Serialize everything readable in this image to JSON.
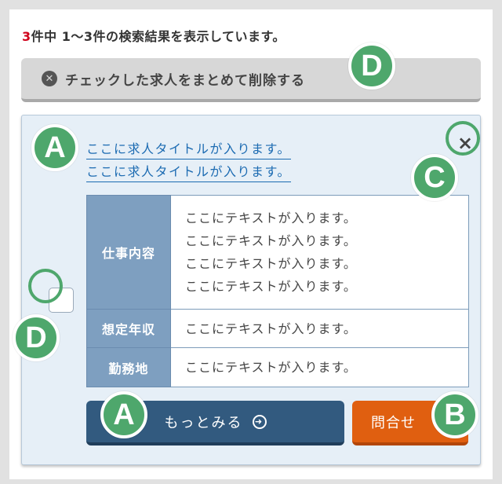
{
  "result_summary": {
    "count": "3",
    "text": "件中 1〜3件の検索結果を表示しています。"
  },
  "bulk_delete": {
    "icon": "close-circle-icon",
    "label": "チェックした求人をまとめて削除する"
  },
  "job_card": {
    "titles": [
      "ここに求人タイトルが入ります。",
      "ここに求人タイトルが入ります。"
    ],
    "close_icon": "×",
    "table": {
      "job_description_label": "仕事内容",
      "job_description_lines": [
        "ここにテキストが入ります。",
        "ここにテキストが入ります。",
        "ここにテキストが入ります。",
        "ここにテキストが入ります。"
      ],
      "salary_label": "想定年収",
      "salary_value": "ここにテキストが入ります。",
      "location_label": "勤務地",
      "location_value": "ここにテキストが入ります。"
    },
    "more_button": {
      "label": "もっとみる",
      "icon": "arrow-right-circle-icon"
    },
    "contact_button": {
      "label": "問合せ"
    }
  },
  "annotation_markers": {
    "a1": "A",
    "a2": "A",
    "b": "B",
    "c": "C",
    "d1": "D",
    "d2": "D"
  },
  "colors": {
    "accent_blue": "#325a7f",
    "contact_orange": "#e05f10",
    "marker_green": "#4ea76c",
    "link_blue": "#1c6bb2",
    "count_red": "#d0021b"
  }
}
